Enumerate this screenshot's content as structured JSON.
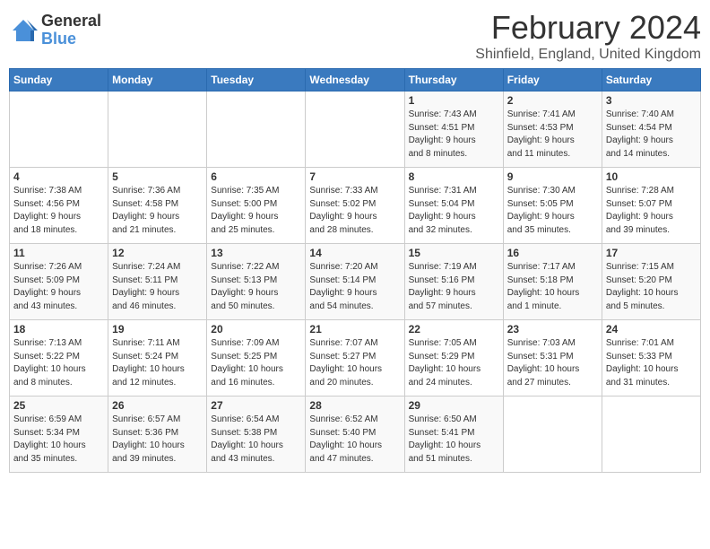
{
  "logo": {
    "general": "General",
    "blue": "Blue"
  },
  "title": "February 2024",
  "location": "Shinfield, England, United Kingdom",
  "days_of_week": [
    "Sunday",
    "Monday",
    "Tuesday",
    "Wednesday",
    "Thursday",
    "Friday",
    "Saturday"
  ],
  "weeks": [
    [
      {
        "day": "",
        "info": ""
      },
      {
        "day": "",
        "info": ""
      },
      {
        "day": "",
        "info": ""
      },
      {
        "day": "",
        "info": ""
      },
      {
        "day": "1",
        "info": "Sunrise: 7:43 AM\nSunset: 4:51 PM\nDaylight: 9 hours\nand 8 minutes."
      },
      {
        "day": "2",
        "info": "Sunrise: 7:41 AM\nSunset: 4:53 PM\nDaylight: 9 hours\nand 11 minutes."
      },
      {
        "day": "3",
        "info": "Sunrise: 7:40 AM\nSunset: 4:54 PM\nDaylight: 9 hours\nand 14 minutes."
      }
    ],
    [
      {
        "day": "4",
        "info": "Sunrise: 7:38 AM\nSunset: 4:56 PM\nDaylight: 9 hours\nand 18 minutes."
      },
      {
        "day": "5",
        "info": "Sunrise: 7:36 AM\nSunset: 4:58 PM\nDaylight: 9 hours\nand 21 minutes."
      },
      {
        "day": "6",
        "info": "Sunrise: 7:35 AM\nSunset: 5:00 PM\nDaylight: 9 hours\nand 25 minutes."
      },
      {
        "day": "7",
        "info": "Sunrise: 7:33 AM\nSunset: 5:02 PM\nDaylight: 9 hours\nand 28 minutes."
      },
      {
        "day": "8",
        "info": "Sunrise: 7:31 AM\nSunset: 5:04 PM\nDaylight: 9 hours\nand 32 minutes."
      },
      {
        "day": "9",
        "info": "Sunrise: 7:30 AM\nSunset: 5:05 PM\nDaylight: 9 hours\nand 35 minutes."
      },
      {
        "day": "10",
        "info": "Sunrise: 7:28 AM\nSunset: 5:07 PM\nDaylight: 9 hours\nand 39 minutes."
      }
    ],
    [
      {
        "day": "11",
        "info": "Sunrise: 7:26 AM\nSunset: 5:09 PM\nDaylight: 9 hours\nand 43 minutes."
      },
      {
        "day": "12",
        "info": "Sunrise: 7:24 AM\nSunset: 5:11 PM\nDaylight: 9 hours\nand 46 minutes."
      },
      {
        "day": "13",
        "info": "Sunrise: 7:22 AM\nSunset: 5:13 PM\nDaylight: 9 hours\nand 50 minutes."
      },
      {
        "day": "14",
        "info": "Sunrise: 7:20 AM\nSunset: 5:14 PM\nDaylight: 9 hours\nand 54 minutes."
      },
      {
        "day": "15",
        "info": "Sunrise: 7:19 AM\nSunset: 5:16 PM\nDaylight: 9 hours\nand 57 minutes."
      },
      {
        "day": "16",
        "info": "Sunrise: 7:17 AM\nSunset: 5:18 PM\nDaylight: 10 hours\nand 1 minute."
      },
      {
        "day": "17",
        "info": "Sunrise: 7:15 AM\nSunset: 5:20 PM\nDaylight: 10 hours\nand 5 minutes."
      }
    ],
    [
      {
        "day": "18",
        "info": "Sunrise: 7:13 AM\nSunset: 5:22 PM\nDaylight: 10 hours\nand 8 minutes."
      },
      {
        "day": "19",
        "info": "Sunrise: 7:11 AM\nSunset: 5:24 PM\nDaylight: 10 hours\nand 12 minutes."
      },
      {
        "day": "20",
        "info": "Sunrise: 7:09 AM\nSunset: 5:25 PM\nDaylight: 10 hours\nand 16 minutes."
      },
      {
        "day": "21",
        "info": "Sunrise: 7:07 AM\nSunset: 5:27 PM\nDaylight: 10 hours\nand 20 minutes."
      },
      {
        "day": "22",
        "info": "Sunrise: 7:05 AM\nSunset: 5:29 PM\nDaylight: 10 hours\nand 24 minutes."
      },
      {
        "day": "23",
        "info": "Sunrise: 7:03 AM\nSunset: 5:31 PM\nDaylight: 10 hours\nand 27 minutes."
      },
      {
        "day": "24",
        "info": "Sunrise: 7:01 AM\nSunset: 5:33 PM\nDaylight: 10 hours\nand 31 minutes."
      }
    ],
    [
      {
        "day": "25",
        "info": "Sunrise: 6:59 AM\nSunset: 5:34 PM\nDaylight: 10 hours\nand 35 minutes."
      },
      {
        "day": "26",
        "info": "Sunrise: 6:57 AM\nSunset: 5:36 PM\nDaylight: 10 hours\nand 39 minutes."
      },
      {
        "day": "27",
        "info": "Sunrise: 6:54 AM\nSunset: 5:38 PM\nDaylight: 10 hours\nand 43 minutes."
      },
      {
        "day": "28",
        "info": "Sunrise: 6:52 AM\nSunset: 5:40 PM\nDaylight: 10 hours\nand 47 minutes."
      },
      {
        "day": "29",
        "info": "Sunrise: 6:50 AM\nSunset: 5:41 PM\nDaylight: 10 hours\nand 51 minutes."
      },
      {
        "day": "",
        "info": ""
      },
      {
        "day": "",
        "info": ""
      }
    ]
  ]
}
